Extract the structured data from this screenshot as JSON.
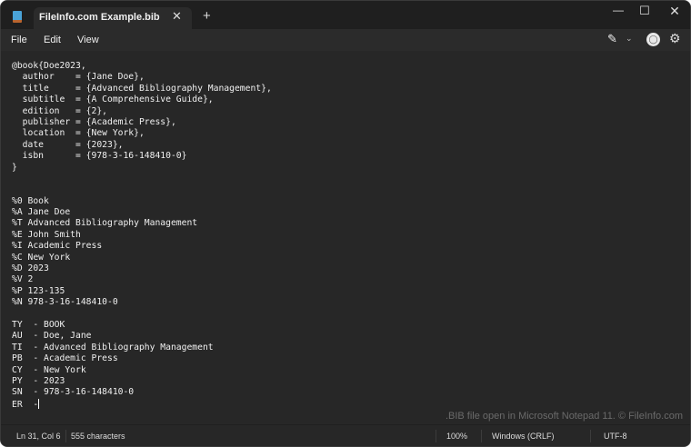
{
  "window": {
    "tab_title": "FileInfo.com Example.bib"
  },
  "menu": {
    "file": "File",
    "edit": "Edit",
    "view": "View"
  },
  "editor": {
    "lines": [
      "@book{Doe2023,",
      "  author    = {Jane Doe},",
      "  title     = {Advanced Bibliography Management},",
      "  subtitle  = {A Comprehensive Guide},",
      "  edition   = {2},",
      "  publisher = {Academic Press},",
      "  location  = {New York},",
      "  date      = {2023},",
      "  isbn      = {978-3-16-148410-0}",
      "}",
      "",
      "",
      "%0 Book",
      "%A Jane Doe",
      "%T Advanced Bibliography Management",
      "%E John Smith",
      "%I Academic Press",
      "%C New York",
      "%D 2023",
      "%V 2",
      "%P 123-135",
      "%N 978-3-16-148410-0",
      "",
      "TY  - BOOK",
      "AU  - Doe, Jane",
      "TI  - Advanced Bibliography Management",
      "PB  - Academic Press",
      "CY  - New York",
      "PY  - 2023",
      "SN  - 978-3-16-148410-0",
      "ER  -"
    ]
  },
  "watermark": ".BIB file open in Microsoft Notepad 11. © FileInfo.com",
  "status": {
    "position": "Ln 31, Col 6",
    "characters": "555 characters",
    "zoom": "100%",
    "line_ending": "Windows (CRLF)",
    "encoding": "UTF-8"
  }
}
